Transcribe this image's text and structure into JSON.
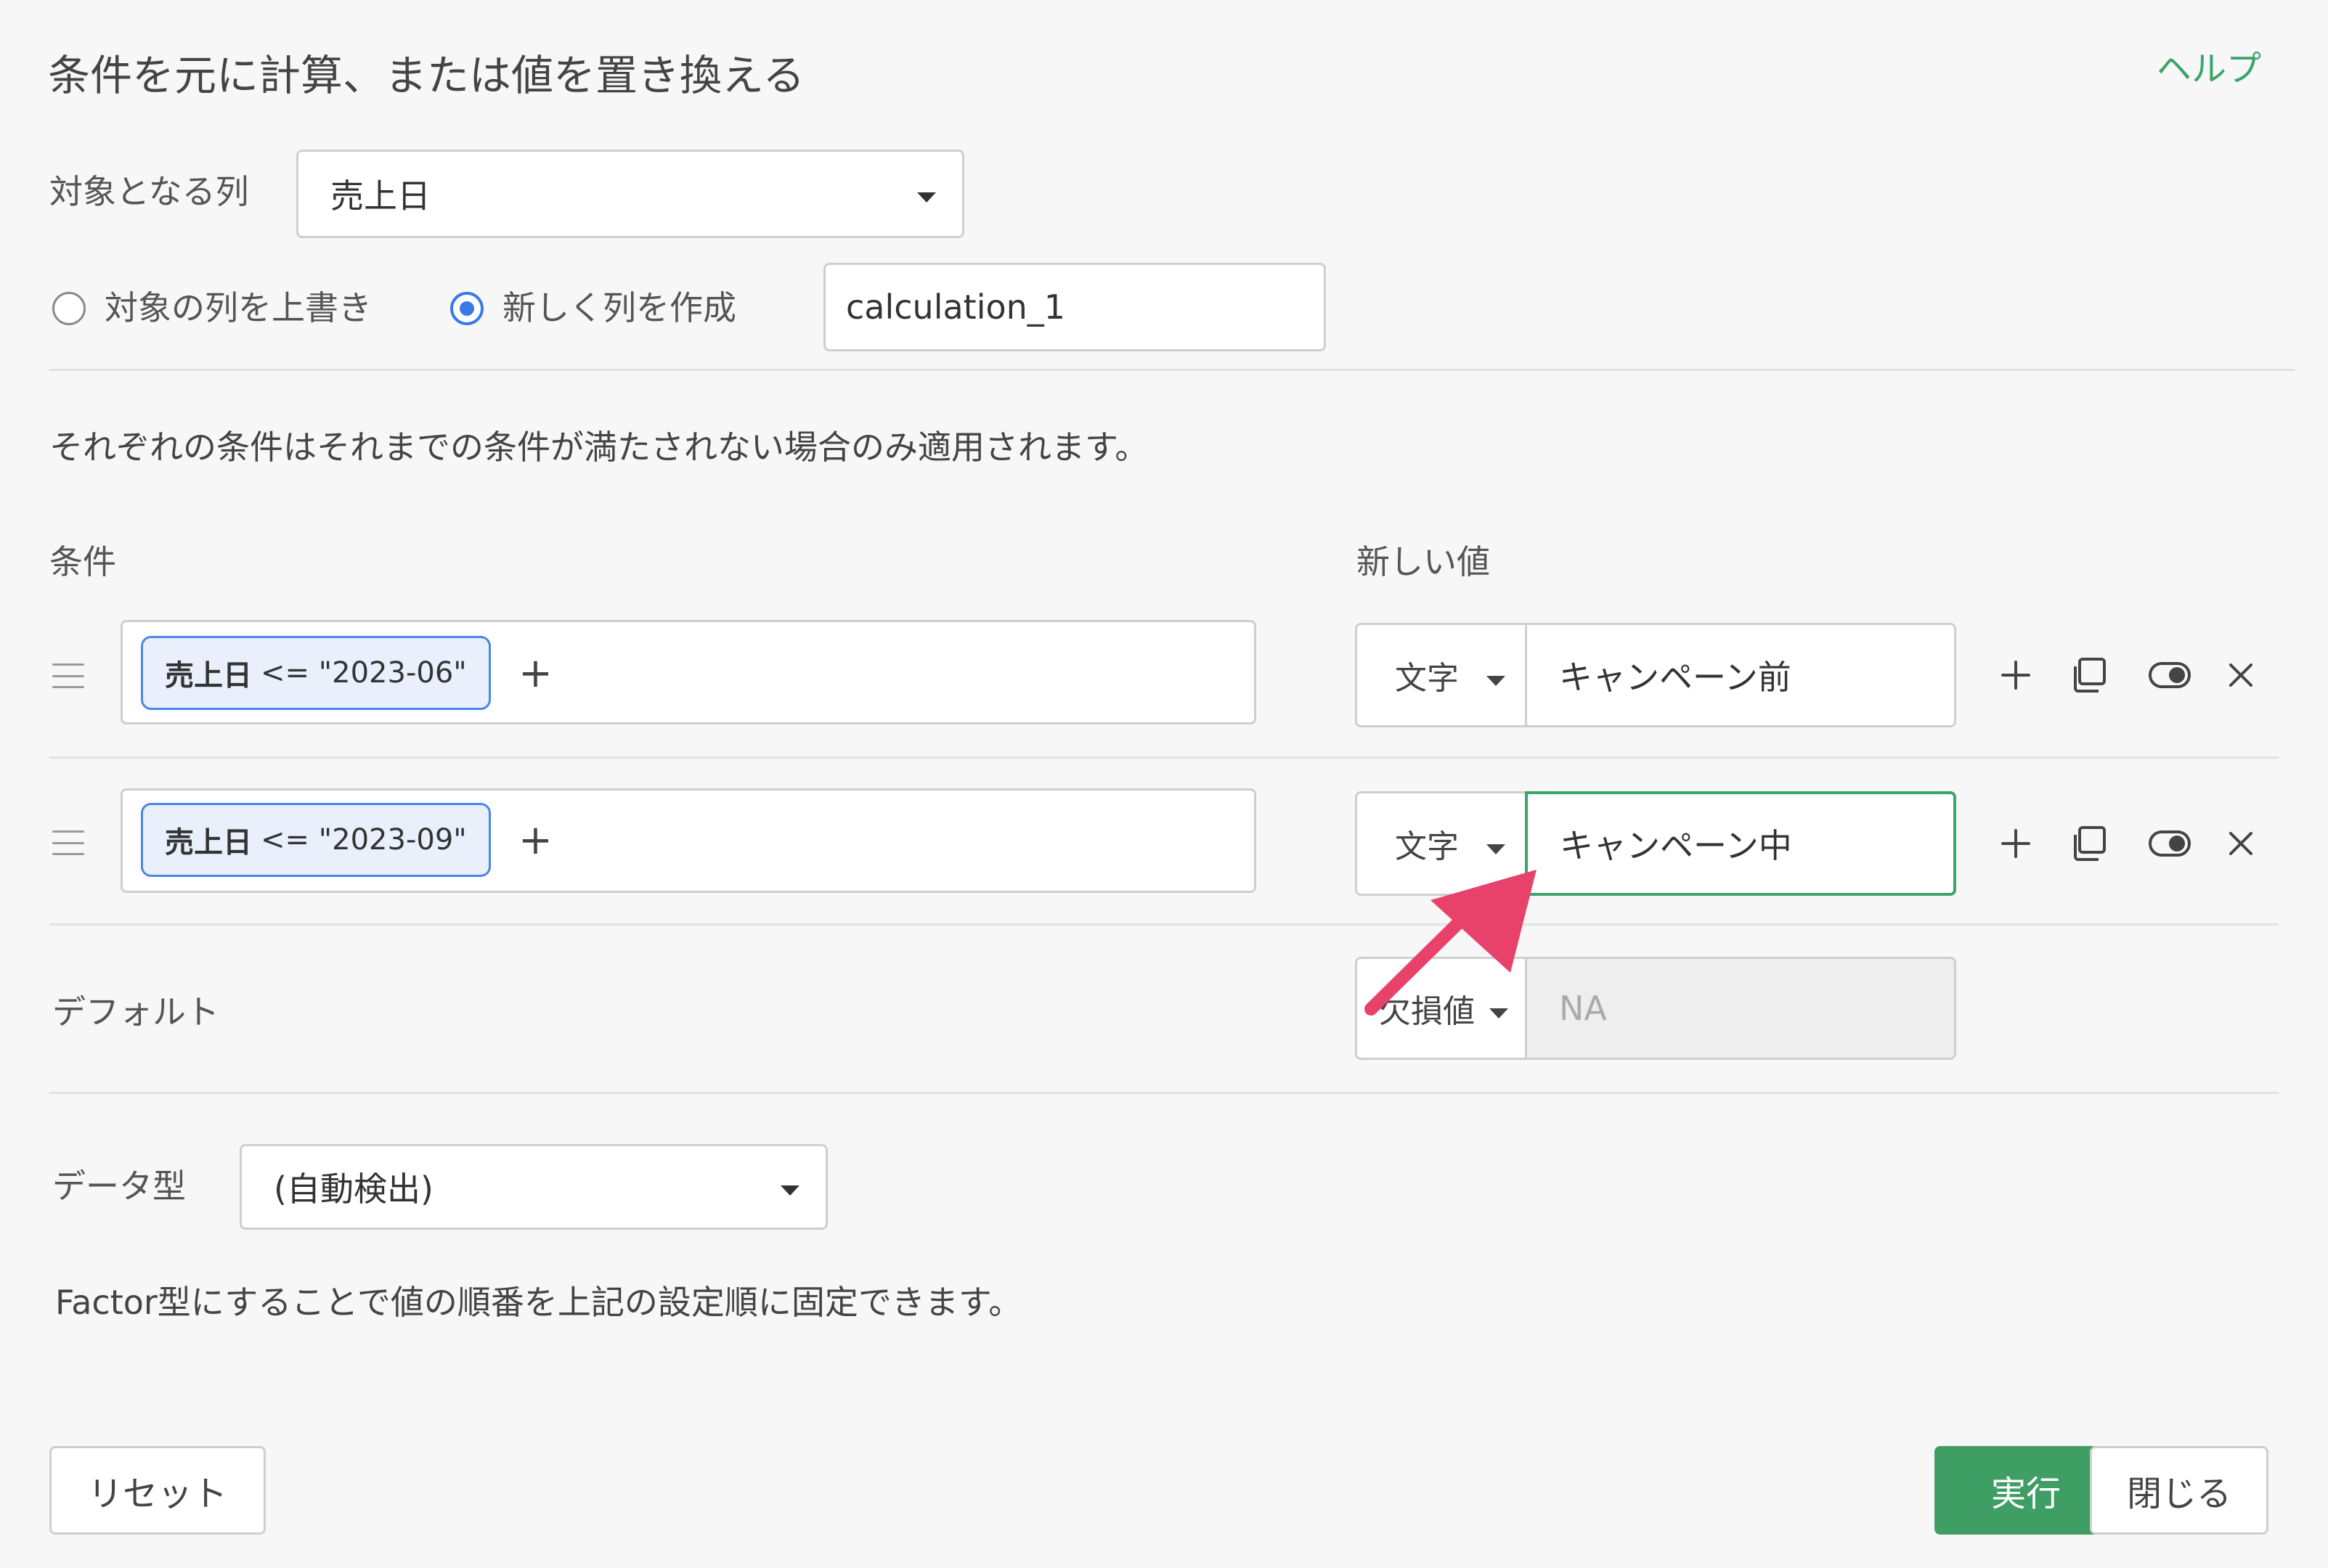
{
  "dialog": {
    "title": "条件を元に計算、または値を置き換える",
    "help_label": "ヘルプ"
  },
  "target": {
    "label": "対象となる列",
    "selected": "売上日"
  },
  "output_mode": {
    "overwrite_label": "対象の列を上書き",
    "new_column_label": "新しく列を作成",
    "selected": "new_column",
    "new_column_name": "calculation_1"
  },
  "notes": {
    "conditions_note": "それぞれの条件はそれまでの条件が満たされない場合のみ適用されます。",
    "factor_note": "Factor型にすることで値の順番を上記の設定順に固定できます。"
  },
  "headers": {
    "condition": "条件",
    "new_value": "新しい値"
  },
  "rules": [
    {
      "column": "売上日",
      "expression": "<= \"2023-06\"",
      "value_type": "文字",
      "value": "キャンペーン前"
    },
    {
      "column": "売上日",
      "expression": "<= \"2023-09\"",
      "value_type": "文字",
      "value": "キャンペーン中"
    }
  ],
  "default_row": {
    "label": "デフォルト",
    "value_type": "欠損値",
    "value": "NA"
  },
  "data_type": {
    "label": "データ型",
    "selected": "(自動検出)"
  },
  "buttons": {
    "reset": "リセット",
    "run": "実行",
    "close": "閉じる"
  },
  "icons": {
    "add_condition": "plus-icon",
    "add_row": "plus-icon",
    "duplicate": "copy-icon",
    "toggle": "toggle-icon",
    "delete": "close-icon",
    "drag": "drag-handle-icon"
  },
  "colors": {
    "accent_green": "#3aa56b",
    "primary_button": "#3e9e64",
    "chip_border": "#4b86e8",
    "chip_bg": "#e9f0fc",
    "radio_blue": "#3b78e7",
    "arrow": "#e8416a"
  }
}
